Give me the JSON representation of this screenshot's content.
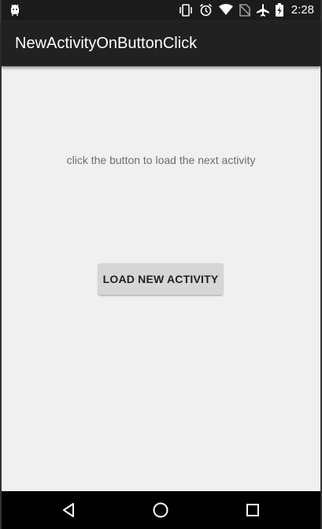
{
  "status_bar": {
    "left_icon": "android-debug-icon",
    "icons": [
      "vibrate-icon",
      "alarm-icon",
      "wifi-icon",
      "no-sim-icon",
      "airplane-mode-icon",
      "battery-charging-icon"
    ],
    "time": "2:28"
  },
  "app_bar": {
    "title": "NewActivityOnButtonClick",
    "background_color": "#212121"
  },
  "main": {
    "instruction_text": "click the button to load the next activity",
    "load_button_label": "LOAD NEW ACTIVITY",
    "background_color": "#f1f0f1"
  },
  "nav_bar": {
    "buttons": [
      "back-icon",
      "home-icon",
      "recents-icon"
    ]
  }
}
